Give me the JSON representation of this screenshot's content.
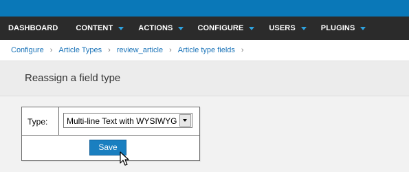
{
  "nav": {
    "items": [
      {
        "label": "DASHBOARD",
        "has_dropdown": false
      },
      {
        "label": "CONTENT",
        "has_dropdown": true
      },
      {
        "label": "ACTIONS",
        "has_dropdown": true
      },
      {
        "label": "CONFIGURE",
        "has_dropdown": true
      },
      {
        "label": "USERS",
        "has_dropdown": true
      },
      {
        "label": "PLUGINS",
        "has_dropdown": true
      }
    ]
  },
  "breadcrumb": {
    "items": [
      {
        "label": "Configure"
      },
      {
        "label": "Article Types"
      },
      {
        "label": "review_article"
      },
      {
        "label": "Article type fields"
      }
    ],
    "separator": "›"
  },
  "page": {
    "title": "Reassign a field type"
  },
  "form": {
    "type_label": "Type:",
    "type_value": "Multi-line Text with WYSIWYG",
    "save_label": "Save"
  },
  "colors": {
    "topbar": "#0a78b8",
    "navbar": "#2b2b2b",
    "accent": "#2ea3e0",
    "button": "#1a7fc0",
    "link": "#1a73b8"
  },
  "icons": {
    "nav_caret": "caret-down-icon",
    "select_arrow": "chevron-down-icon",
    "cursor": "mouse-pointer-icon"
  }
}
